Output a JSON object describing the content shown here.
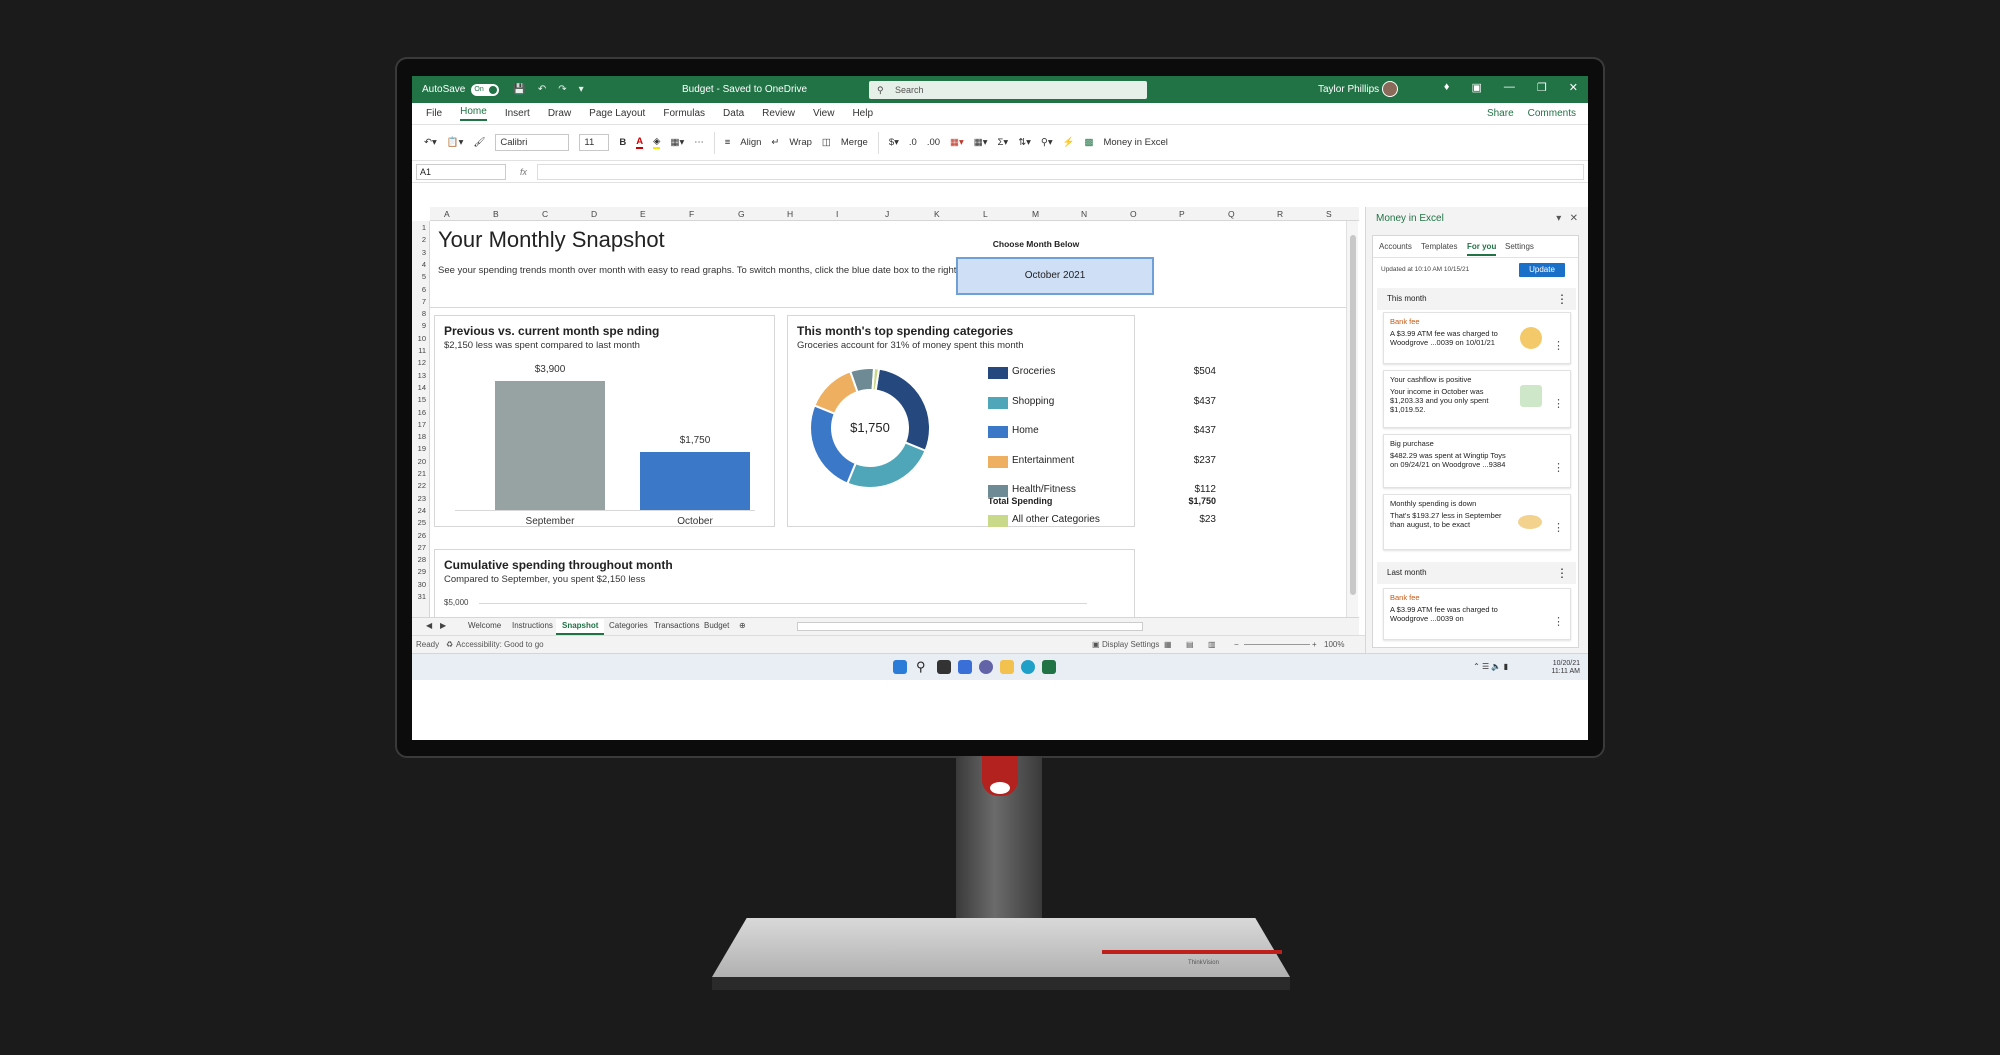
{
  "window": {
    "autosave_label": "AutoSave",
    "autosave_state": "On",
    "doc_title": "Budget - Saved to OneDrive",
    "search_placeholder": "Search",
    "user_name": "Taylor Phillips",
    "accent": "#217346"
  },
  "menu": {
    "items": [
      "File",
      "Home",
      "Insert",
      "Draw",
      "Page Layout",
      "Formulas",
      "Data",
      "Review",
      "View",
      "Help"
    ],
    "active": "Home",
    "share": "Share",
    "comments": "Comments"
  },
  "ribbon": {
    "font": "Calibri",
    "size": "11",
    "align": "Align",
    "wrap": "Wrap",
    "merge": "Merge",
    "addin": "Money in Excel"
  },
  "formula_bar": {
    "cell": "A1",
    "fx": "fx"
  },
  "columns": [
    "A",
    "B",
    "C",
    "D",
    "E",
    "F",
    "G",
    "H",
    "I",
    "J",
    "K",
    "L",
    "M",
    "N",
    "O",
    "P",
    "Q",
    "R",
    "S"
  ],
  "rows": [
    "1",
    "2",
    "3",
    "4",
    "5",
    "6",
    "7",
    "8",
    "9",
    "10",
    "11",
    "12",
    "13",
    "14",
    "15",
    "16",
    "17",
    "18",
    "19",
    "20",
    "21",
    "22",
    "23",
    "24",
    "25",
    "26",
    "27",
    "28",
    "29",
    "30",
    "31"
  ],
  "snapshot": {
    "title": "Your Monthly Snapshot",
    "desc": "See your spending trends month over month with easy to read graphs. To switch months, click the blue date box to the right.",
    "choose_label": "Choose Month Below",
    "month": "October 2021"
  },
  "prev_vs_current": {
    "title": "Previous vs. current month spe nding",
    "subtitle": "$2,150 less was spent compared to last month"
  },
  "top_categories": {
    "title": "This month's top spending categories",
    "subtitle": "Groceries account for 31% of money spent this month",
    "center_label": "$1,750",
    "total_label": "Total Spending",
    "total_value": "$1,750"
  },
  "cumulative": {
    "title": "Cumulative spending throughout month",
    "subtitle": "Compared to September, you spent $2,150 less",
    "y_tick": "$5,000"
  },
  "chart_data": [
    {
      "type": "bar",
      "categories": [
        "September",
        "October"
      ],
      "values": [
        3900,
        1750
      ],
      "value_labels": [
        "$3,900",
        "$1,750"
      ],
      "colors": [
        "#97a3a3",
        "#3c78c8"
      ],
      "ylim": [
        0,
        4000
      ]
    },
    {
      "type": "pie",
      "donut": true,
      "categories": [
        "Groceries",
        "Shopping",
        "Home",
        "Entertainment",
        "Health/Fitness",
        "All other Categories"
      ],
      "values": [
        504,
        437,
        437,
        237,
        112,
        23
      ],
      "value_labels": [
        "$504",
        "$437",
        "$437",
        "$237",
        "$112",
        "$23"
      ],
      "colors": [
        "#25497e",
        "#4ea6b8",
        "#3c78c8",
        "#eeb060",
        "#6e8a94",
        "#c9d98a"
      ]
    }
  ],
  "sheet_tabs": [
    "Welcome",
    "Instructions",
    "Snapshot",
    "Categories",
    "Transactions",
    "Budget"
  ],
  "active_sheet": "Snapshot",
  "status": {
    "ready": "Ready",
    "accessibility": "Accessibility: Good to go",
    "display_settings": "Display Settings",
    "zoom": "100%"
  },
  "taskbar": {
    "date": "10/20/21",
    "time": "11:11 AM"
  },
  "pane": {
    "title": "Money in Excel",
    "tabs": [
      "Accounts",
      "Templates",
      "For you",
      "Settings"
    ],
    "active_tab": "For you",
    "updated": "Updated at 10:10 AM 10/15/21",
    "update_btn": "Update",
    "this_month": "This month",
    "last_month": "Last month",
    "insights": [
      {
        "head": "Bank fee",
        "body": "A $3.99 ATM fee was charged to Woodgrove ...0039 on 10/01/21"
      },
      {
        "head": "Your cashflow is positive",
        "body": "Your income in October was $1,203.33 and you only spent $1,019.52."
      },
      {
        "head": "Big purchase",
        "body": "$482.29 was spent at Wingtip Toys on 09/24/21 on Woodgrove ...9384"
      },
      {
        "head": "Monthly spending is down",
        "body": "That's $193.27 less in September than august, to be exact"
      },
      {
        "head": "Bank fee",
        "body": "A $3.99 ATM fee was charged to Woodgrove ...0039 on"
      }
    ]
  },
  "monitor": {
    "brand": "ThinkVision"
  }
}
